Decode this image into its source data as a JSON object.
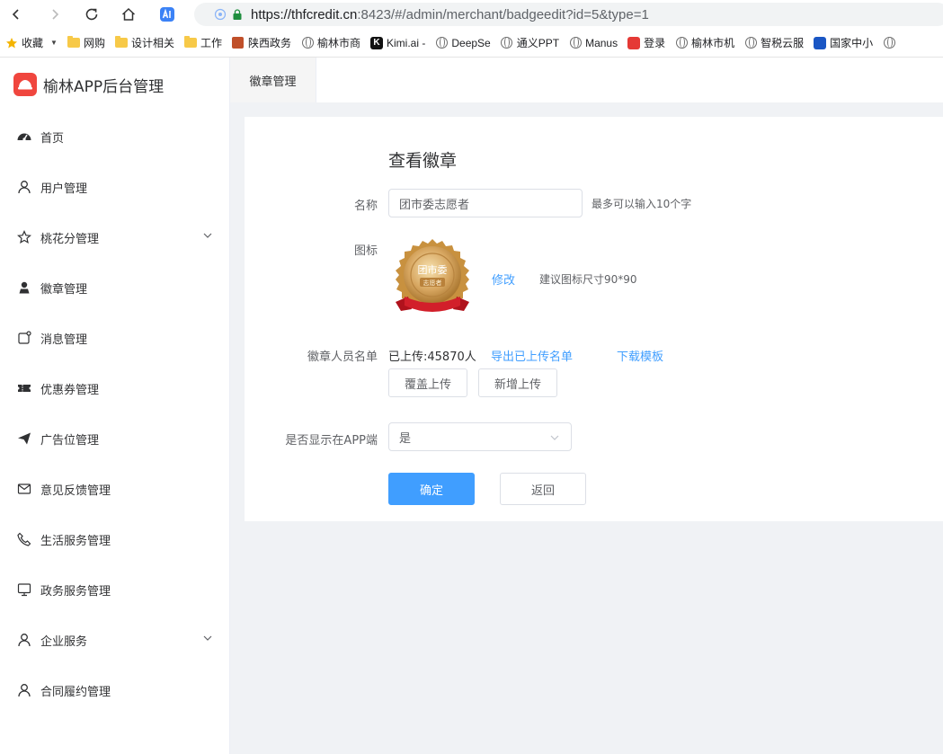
{
  "browser": {
    "url_host": "https://thfcredit.cn",
    "url_rest": ":8423/#/admin/merchant/badgeedit?id=5&type=1",
    "bookmarks": [
      "收藏",
      "网购",
      "设计相关",
      "工作",
      "陕西政务",
      "榆林市商",
      "Kimi.ai -",
      "DeepSe",
      "通义PPT",
      "Manus",
      "登录",
      "榆林市机",
      "智税云服",
      "国家中小"
    ]
  },
  "sidebar": {
    "title": "榆林APP后台管理",
    "items": [
      {
        "label": "首页",
        "icon": "dashboard-icon"
      },
      {
        "label": "用户管理",
        "icon": "user-icon"
      },
      {
        "label": "桃花分管理",
        "icon": "star-icon",
        "expandable": true
      },
      {
        "label": "徽章管理",
        "icon": "person-solid-icon"
      },
      {
        "label": "消息管理",
        "icon": "message-icon"
      },
      {
        "label": "优惠券管理",
        "icon": "ticket-icon"
      },
      {
        "label": "广告位管理",
        "icon": "send-icon"
      },
      {
        "label": "意见反馈管理",
        "icon": "mail-icon"
      },
      {
        "label": "生活服务管理",
        "icon": "phone-icon"
      },
      {
        "label": "政务服务管理",
        "icon": "monitor-icon"
      },
      {
        "label": "企业服务",
        "icon": "user-icon",
        "expandable": true
      },
      {
        "label": "合同履约管理",
        "icon": "user-icon"
      }
    ]
  },
  "tabs": {
    "active": "徽章管理"
  },
  "form": {
    "title": "查看徽章",
    "name_label": "名称",
    "name_value": "团市委志愿者",
    "name_hint": "最多可以输入10个字",
    "icon_label": "图标",
    "badge_text_top": "团市委",
    "badge_text_bottom": "志愿者",
    "modify_link": "修改",
    "icon_hint": "建议图标尺寸90*90",
    "members_label": "徽章人员名单",
    "uploaded_text": "已上传:45870人",
    "export_link": "导出已上传名单",
    "download_link": "下载模板",
    "overwrite_button": "覆盖上传",
    "add_button": "新增上传",
    "display_label": "是否显示在APP端",
    "display_value": "是",
    "confirm_button": "确定",
    "back_button": "返回"
  },
  "colors": {
    "primary": "#409eff",
    "brand": "#f0463e"
  }
}
